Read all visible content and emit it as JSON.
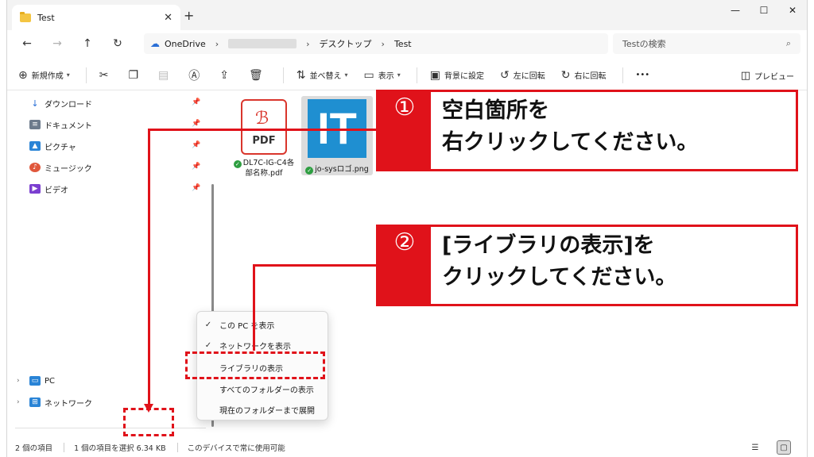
{
  "tab": {
    "title": "Test",
    "close": "✕",
    "new_tab": "+"
  },
  "window_controls": {
    "minimize": "—",
    "maximize": "☐",
    "close": "✕"
  },
  "nav": {
    "back": "←",
    "forward": "→",
    "up": "↑",
    "refresh": "↻"
  },
  "address": {
    "root": "OneDrive",
    "crumb2": "デスクトップ",
    "crumb3": "Test",
    "sep": "›"
  },
  "search": {
    "placeholder": "Testの検索"
  },
  "toolbar": {
    "new": "新規作成",
    "sort": "並べ替え",
    "view": "表示",
    "set_background": "背景に設定",
    "rotate_left": "左に回転",
    "rotate_right": "右に回転",
    "more": "•••",
    "preview": "プレビュー"
  },
  "sidebar": {
    "items": [
      {
        "label": "ダウンロード",
        "color": "#2a6fd6"
      },
      {
        "label": "ドキュメント",
        "color": "#6d7b8c"
      },
      {
        "label": "ピクチャ",
        "color": "#2a84d6"
      },
      {
        "label": "ミュージック",
        "color": "#e0573b"
      },
      {
        "label": "ビデオ",
        "color": "#7b3fd0"
      }
    ],
    "bottom": [
      {
        "label": "PC"
      },
      {
        "label": "ネットワーク"
      }
    ]
  },
  "files": [
    {
      "name_line1": "DL7C-IG-C4各",
      "name_line2": "部名称.pdf",
      "icon_label": "PDF",
      "synced": true
    },
    {
      "name_line1": "jo-sysロゴ.png",
      "icon_label": "IT",
      "synced": true
    }
  ],
  "context_menu": {
    "items": [
      {
        "label": "この PC を表示",
        "checked": "✓"
      },
      {
        "label": "ネットワークを表示",
        "checked": "✓"
      },
      {
        "label": "ライブラリの表示",
        "checked": ""
      },
      {
        "label": "すべてのフォルダーの表示",
        "checked": ""
      },
      {
        "label": "現在のフォルダーまで展開",
        "checked": ""
      }
    ]
  },
  "status": {
    "count": "2 個の項目",
    "selected": "1 個の項目を選択  6.34 KB",
    "availability": "このデバイスで常に使用可能"
  },
  "annotations": {
    "step1": {
      "num": "①",
      "line1": "空白箇所を",
      "line2": "右クリックしてください。"
    },
    "step2": {
      "num": "②",
      "line1": "[ライブラリの表示]を",
      "line2": "クリックしてください。"
    }
  },
  "colors": {
    "accent_red": "#e0121a",
    "folder_yellow": "#f4c542",
    "it_blue": "#1f8fd1",
    "pdf_red": "#d9352c"
  }
}
